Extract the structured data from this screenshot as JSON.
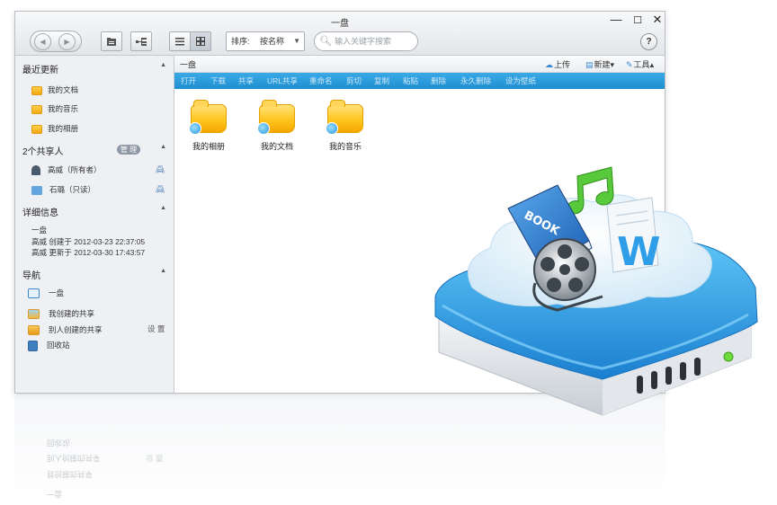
{
  "window": {
    "title": "一盘",
    "controls": {
      "minimize": "—",
      "maximize": "☐",
      "close": "✕"
    }
  },
  "toolbar": {
    "back": "◀",
    "forward": "▶",
    "sort_label": "排序:",
    "sort_value": "按名称",
    "search_placeholder": "输入关键字搜索",
    "help": "?"
  },
  "sidebar": {
    "recent": {
      "title": "最近更新",
      "items": [
        "我的文档",
        "我的音乐",
        "我的相册"
      ]
    },
    "sharers": {
      "title": "2个共享人",
      "manage": "管 理",
      "people": [
        "高威（所有者）",
        "石璐（只读）"
      ]
    },
    "details": {
      "title": "详细信息",
      "name": "一盘",
      "created": "高威 创建于 2012-03-23 22:37:05",
      "updated": "高威 更新于 2012-03-30 17:43:57"
    },
    "nav": {
      "title": "导航",
      "items": [
        "一盘",
        "我创建的共享",
        "别人创建的共享",
        "回收站"
      ],
      "settings": "设 置"
    }
  },
  "content": {
    "breadcrumb": "一盘",
    "upload": "上传",
    "new": "新建",
    "tools": "工具",
    "actions": [
      "打开",
      "下载",
      "共享",
      "URL共享",
      "重命名",
      "剪切",
      "复制",
      "粘贴",
      "删除",
      "永久删除",
      "设为壁纸"
    ],
    "files": [
      "我的相册",
      "我的文档",
      "我的音乐"
    ]
  },
  "illustration": {
    "book_label": "BOOK",
    "word_letter": "W"
  }
}
